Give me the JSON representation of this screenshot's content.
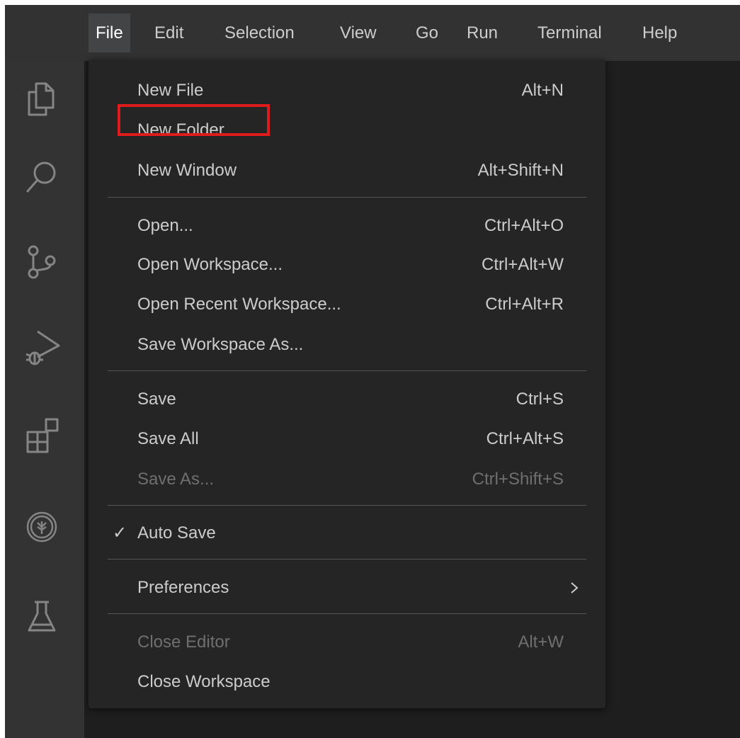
{
  "menubar": {
    "items": [
      {
        "label": "File",
        "active": true
      },
      {
        "label": "Edit"
      },
      {
        "label": "Selection"
      },
      {
        "label": "View"
      },
      {
        "label": "Go"
      },
      {
        "label": "Run"
      },
      {
        "label": "Terminal"
      },
      {
        "label": "Help"
      }
    ]
  },
  "activitybar": {
    "icons": [
      "explorer-icon",
      "search-icon",
      "source-control-icon",
      "run-debug-icon",
      "extensions-icon",
      "tree-badge-icon",
      "testing-flask-icon"
    ],
    "icon_color": "#858585"
  },
  "file_menu": {
    "items": [
      {
        "label": "New File",
        "shortcut": "Alt+N"
      },
      {
        "label": "New Folder",
        "shortcut": "",
        "highlighted": true
      },
      {
        "label": "New Window",
        "shortcut": "Alt+Shift+N"
      },
      {
        "label": "Open...",
        "shortcut": "Ctrl+Alt+O"
      },
      {
        "label": "Open Workspace...",
        "shortcut": "Ctrl+Alt+W"
      },
      {
        "label": "Open Recent Workspace...",
        "shortcut": "Ctrl+Alt+R"
      },
      {
        "label": "Save Workspace As...",
        "shortcut": ""
      },
      {
        "label": "Save",
        "shortcut": "Ctrl+S"
      },
      {
        "label": "Save All",
        "shortcut": "Ctrl+Alt+S"
      },
      {
        "label": "Save As...",
        "shortcut": "Ctrl+Shift+S",
        "disabled": true
      },
      {
        "label": "Auto Save",
        "shortcut": "",
        "checked": true,
        "check_glyph": "✓"
      },
      {
        "label": "Preferences",
        "shortcut": "",
        "submenu": true
      },
      {
        "label": "Close Editor",
        "shortcut": "Alt+W",
        "disabled": true
      },
      {
        "label": "Close Workspace",
        "shortcut": ""
      }
    ]
  },
  "colors": {
    "highlight_border": "#e01b1b",
    "menu_bg": "#252526",
    "menubar_bg": "#323233",
    "text": "#cccccc",
    "disabled_text": "#6f6f6f"
  }
}
